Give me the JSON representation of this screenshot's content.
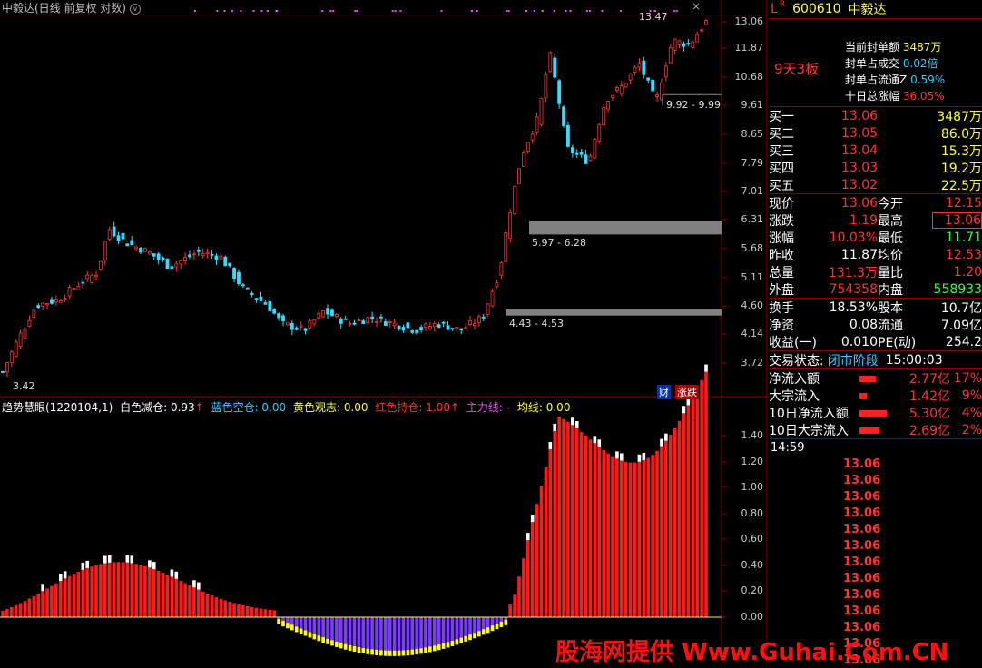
{
  "chart": {
    "title": "中毅达(日线 前复权 对数)",
    "close_icon": "×",
    "dropdown_icon": "chevron-down-icon",
    "price_axis_labels": [
      "13.06",
      "11.87",
      "10.68",
      "9.61",
      "8.65",
      "7.79",
      "7.01",
      "6.31",
      "5.68",
      "5.11",
      "4.60",
      "4.14",
      "3.72"
    ],
    "high_marker": "13.47",
    "low_marker": "3.42",
    "zone_labels": [
      "9.92 - 9.99",
      "5.97 - 6.28",
      "4.43 - 4.53"
    ],
    "badges": {
      "finance": "财",
      "limit_up": "涨跌"
    },
    "indicator_axis_labels": [
      "1.40",
      "1.20",
      "1.00",
      "0.80",
      "0.60",
      "0.40",
      "0.20",
      "0.00"
    ]
  },
  "indicator": {
    "name": "趋势慧眼(1220104,1)",
    "white_label": "白色减仓: 0.93",
    "white_arrow": "↑",
    "blue_label": "蓝色空仓: 0.00",
    "yellow_label": "黄色观志: 0.00",
    "red_label": "红色持仓: 1.00",
    "red_arrow": "↑",
    "main_label": "主力线: -",
    "avg_label": "均线: 0.00"
  },
  "colors": {
    "up": "#ff3333",
    "down": "#33ddff",
    "grid": "#8b0000",
    "purple": "#7b3cff",
    "yellow": "#ffff00"
  },
  "quote": {
    "flag_l": "L",
    "flag_r": "R",
    "code": "600610",
    "name": "中毅达",
    "limit_tag": "9天3板",
    "seal": [
      {
        "label": "当前封单额",
        "value": "3487万"
      },
      {
        "label": "封单占成交",
        "value": "0.02倍"
      },
      {
        "label": "封单占流通Z",
        "value": "0.59%"
      },
      {
        "label": "十日总涨幅",
        "value": "36.05%"
      }
    ],
    "bids": [
      {
        "label": "买一",
        "price": "13.06",
        "vol": "3487万"
      },
      {
        "label": "买二",
        "price": "13.05",
        "vol": "86.0万"
      },
      {
        "label": "买三",
        "price": "13.04",
        "vol": "15.3万"
      },
      {
        "label": "买四",
        "price": "13.03",
        "vol": "19.2万"
      },
      {
        "label": "买五",
        "price": "13.02",
        "vol": "22.5万"
      }
    ],
    "stats": [
      {
        "l1": "现价",
        "v1": "13.06",
        "l2": "今开",
        "v2": "12.15"
      },
      {
        "l1": "涨跌",
        "v1": "1.19",
        "l2": "最高",
        "v2": "13.06"
      },
      {
        "l1": "涨幅",
        "v1": "10.03%",
        "l2": "最低",
        "v2": "11.71"
      },
      {
        "l1": "昨收",
        "v1": "11.87",
        "l2": "均价",
        "v2": "12.53"
      },
      {
        "l1": "总量",
        "v1": "131.3万",
        "l2": "量比",
        "v2": "1.20"
      },
      {
        "l1": "外盘",
        "v1": "754358",
        "l2": "内盘",
        "v2": "558933"
      }
    ],
    "stats2": [
      {
        "l1": "换手",
        "v1": "18.53%",
        "l2": "股本",
        "v2": "10.7亿"
      },
      {
        "l1": "净资",
        "v1": "0.08",
        "l2": "流通",
        "v2": "7.09亿"
      },
      {
        "l1": "收益(一)",
        "v1": "0.010",
        "l2": "PE(动)",
        "v2": "254.2"
      }
    ],
    "trade_status_label": "交易状态:",
    "trade_status": "闭市阶段",
    "trade_time": "15:00:03",
    "flows": [
      {
        "label": "净流入额",
        "value": "2.77亿",
        "pct": "17%"
      },
      {
        "label": "大宗流入",
        "value": "1.42亿",
        "pct": "9%"
      },
      {
        "label": "10日净流入额",
        "value": "5.30亿",
        "pct": "4%"
      },
      {
        "label": "10日大宗流入",
        "value": "2.69亿",
        "pct": "2%"
      }
    ],
    "ticks_time": "14:59",
    "ticks": [
      "13.06",
      "13.06",
      "13.06",
      "13.06",
      "13.06",
      "13.06",
      "13.06",
      "13.06",
      "13.06",
      "13.06",
      "13.06",
      "13.06",
      "13.06"
    ]
  },
  "watermark": "股海网提供 Www.Guhai.Com.CN"
}
